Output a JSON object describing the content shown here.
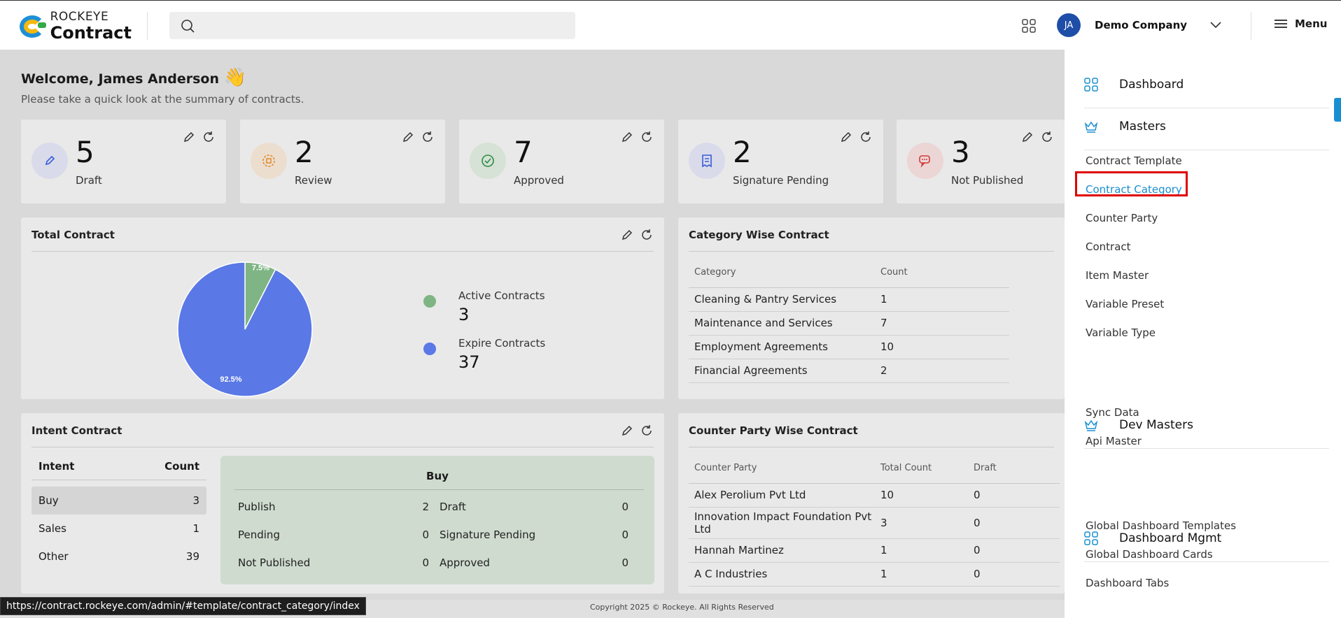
{
  "header": {
    "logo_top": "ROCKEYE",
    "logo_bottom": "Contract",
    "search_placeholder": "",
    "avatar_initials": "JA",
    "company": "Demo Company",
    "menu_label": "Menu"
  },
  "welcome": {
    "title": "Welcome, James Anderson",
    "emoji": "👋",
    "subtitle": "Please take a quick look at the summary of contracts."
  },
  "stats": [
    {
      "value": "5",
      "label": "Draft",
      "color": "#d9dbea",
      "icon_color": "#3a5bd9",
      "icon": "pencil-icon"
    },
    {
      "value": "2",
      "label": "Review",
      "color": "#ecdecf",
      "icon_color": "#e08a2c",
      "icon": "review-icon"
    },
    {
      "value": "7",
      "label": "Approved",
      "color": "#d5e2d5",
      "icon_color": "#2e8b45",
      "icon": "check-icon"
    },
    {
      "value": "2",
      "label": "Signature Pending",
      "color": "#d9dbea",
      "icon_color": "#3a5bd9",
      "icon": "receipt-icon"
    },
    {
      "value": "3",
      "label": "Not Published",
      "color": "#ecd5d5",
      "icon_color": "#d43a3a",
      "icon": "chat-icon"
    }
  ],
  "total_contract": {
    "title": "Total Contract",
    "legend": [
      {
        "name": "Active Contracts",
        "value": "3",
        "color": "#7fb584"
      },
      {
        "name": "Expire Contracts",
        "value": "37",
        "color": "#5a78e6"
      }
    ]
  },
  "chart_data": {
    "type": "pie",
    "title": "Total Contract",
    "series": [
      {
        "name": "Active Contracts",
        "value": 3,
        "percent_label": "7.5%",
        "color": "#7fb584"
      },
      {
        "name": "Expire Contracts",
        "value": 37,
        "percent_label": "92.5%",
        "color": "#5a78e6"
      }
    ]
  },
  "category_wise": {
    "title": "Category Wise Contract",
    "headers": [
      "Category",
      "Count"
    ],
    "rows": [
      [
        "Cleaning & Pantry Services",
        "1"
      ],
      [
        "Maintenance and Services",
        "7"
      ],
      [
        "Employment Agreements",
        "10"
      ],
      [
        "Financial Agreements",
        "2"
      ]
    ]
  },
  "intent": {
    "title": "Intent Contract",
    "headers": [
      "Intent",
      "Count"
    ],
    "rows": [
      {
        "k": "Buy",
        "v": "3"
      },
      {
        "k": "Sales",
        "v": "1"
      },
      {
        "k": "Other",
        "v": "39"
      }
    ],
    "buy_box": {
      "title": "Buy",
      "left": [
        {
          "k": "Publish",
          "v": "2"
        },
        {
          "k": "Pending",
          "v": "0"
        },
        {
          "k": "Not Published",
          "v": "0"
        }
      ],
      "right": [
        {
          "k": "Draft",
          "v": "0"
        },
        {
          "k": "Signature Pending",
          "v": "0"
        },
        {
          "k": "Approved",
          "v": "0"
        }
      ]
    }
  },
  "counter_party": {
    "title": "Counter Party Wise Contract",
    "headers": [
      "Counter Party",
      "Total Count",
      "Draft"
    ],
    "rows": [
      [
        "Alex Perolium Pvt Ltd",
        "10",
        "0"
      ],
      [
        "Innovation Impact Foundation Pvt Ltd",
        "3",
        "0"
      ],
      [
        "Hannah Martinez",
        "1",
        "0"
      ],
      [
        "A C Industries",
        "1",
        "0"
      ]
    ]
  },
  "sidebar": {
    "sections": [
      {
        "label": "Dashboard",
        "icon": "grid-icon",
        "items": []
      },
      {
        "label": "Masters",
        "icon": "crown-icon",
        "items": [
          "Contract Template",
          "Contract Category",
          "Counter Party",
          "Contract",
          "Item Master",
          "Variable Preset",
          "Variable Type"
        ]
      },
      {
        "label": "Dev Masters",
        "icon": "crown-icon",
        "items": [
          "Sync Data",
          "Api Master"
        ]
      },
      {
        "label": "Dashboard Mgmt",
        "icon": "grid-icon",
        "items": [
          "Global Dashboard Templates",
          "Global Dashboard Cards",
          "Dashboard Tabs"
        ]
      }
    ],
    "active_item": "Contract Category"
  },
  "status_url": "https://contract.rockeye.com/admin/#template/contract_category/index",
  "copyright": "Copyright 2025 © Rockeye. All Rights Reserved"
}
